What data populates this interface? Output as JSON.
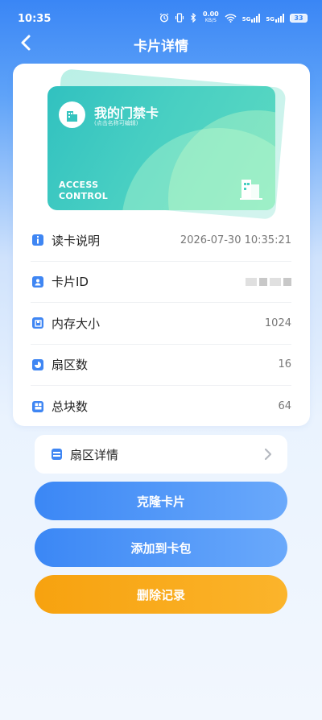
{
  "status": {
    "time": "10:35",
    "net_speed_top": "0.00",
    "net_speed_bottom": "KB/S",
    "sig1": "5G",
    "sig2": "5G",
    "battery": "33"
  },
  "nav": {
    "title": "卡片详情"
  },
  "card": {
    "name": "我的门禁卡",
    "hint": "(点击名称可编辑)",
    "tag_line1": "ACCESS",
    "tag_line2": "CONTROL"
  },
  "info": {
    "read_label": "读卡说明",
    "read_value": "2026-07-30 10:35:21",
    "id_label": "卡片ID",
    "memory_label": "内存大小",
    "memory_value": "1024",
    "sector_label": "扇区数",
    "sector_value": "16",
    "block_label": "总块数",
    "block_value": "64"
  },
  "sector_details": {
    "label": "扇区详情"
  },
  "buttons": {
    "clone": "克隆卡片",
    "add_wallet": "添加到卡包",
    "delete": "删除记录"
  },
  "colors": {
    "accent": "#3b87f5",
    "card_teal": "#31c1c0",
    "danger_orange": "#f7a20f"
  }
}
